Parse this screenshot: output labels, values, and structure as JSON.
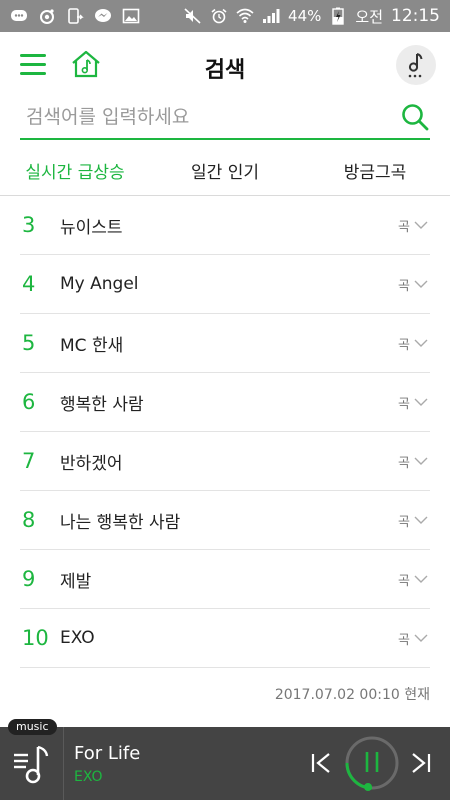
{
  "status_bar": {
    "battery": "44%",
    "ampm": "오전",
    "time": "12:15"
  },
  "header": {
    "title": "검색"
  },
  "search": {
    "placeholder": "검색어를 입력하세요",
    "value": ""
  },
  "tabs": [
    {
      "label": "실시간 급상승",
      "active": true
    },
    {
      "label": "일간 인기",
      "active": false
    },
    {
      "label": "방금그곡",
      "active": false
    }
  ],
  "results": [
    {
      "rank": "3",
      "keyword": "뉴이스트",
      "kind": "곡"
    },
    {
      "rank": "4",
      "keyword": "My Angel",
      "kind": "곡"
    },
    {
      "rank": "5",
      "keyword": "MC 한새",
      "kind": "곡"
    },
    {
      "rank": "6",
      "keyword": "행복한 사람",
      "kind": "곡"
    },
    {
      "rank": "7",
      "keyword": "반하겠어",
      "kind": "곡"
    },
    {
      "rank": "8",
      "keyword": "나는 행복한 사람",
      "kind": "곡"
    },
    {
      "rank": "9",
      "keyword": "제발",
      "kind": "곡"
    },
    {
      "rank": "10",
      "keyword": "EXO",
      "kind": "곡"
    }
  ],
  "timestamp": "2017.07.02 00:10 현재",
  "player": {
    "badge": "music",
    "title": "For Life",
    "artist": "EXO"
  },
  "colors": {
    "accent": "#1db640",
    "status_bar": "#8a8a8a",
    "player_bg": "#444444"
  }
}
